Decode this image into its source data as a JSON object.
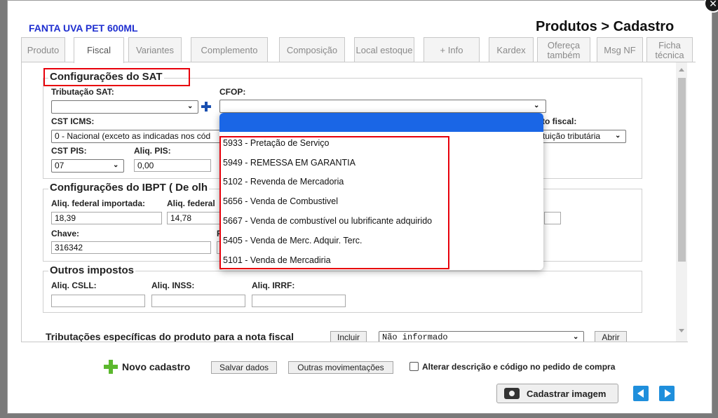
{
  "product_name": "FANTA UVA PET 600ML",
  "page_title": "Produtos > Cadastro",
  "tabs": [
    {
      "label": "Produto"
    },
    {
      "label": "Fiscal"
    },
    {
      "label": "Variantes"
    },
    {
      "label": "Complemento"
    },
    {
      "label": "Composição"
    },
    {
      "label": "Local estoque"
    },
    {
      "label": "+ Info"
    },
    {
      "label": "Kardex"
    },
    {
      "label": "Ofereça também"
    },
    {
      "label": "Msg NF"
    },
    {
      "label": "Ficha técnica"
    }
  ],
  "sat": {
    "legend": "Configurações do SAT",
    "tributacao_label": "Tributação SAT:",
    "tributacao_value": "",
    "cfop_label": "CFOP:",
    "cfop_value": "",
    "cst_icms_label": "CST ICMS:",
    "cst_icms_value": "0 - Nacional (exceto as indicadas nos cód",
    "partial_label_right": "to fiscal:",
    "partial_value_right": "tuição tributária",
    "cst_pis_label": "CST PIS:",
    "cst_pis_value": "07",
    "aliq_pis_label": "Aliq. PIS:",
    "aliq_pis_value": "0,00"
  },
  "ibpt": {
    "legend": "Configurações do IBPT ( De olh",
    "federal_importada_label": "Aliq. federal importada:",
    "federal_importada_value": "18,39",
    "federal_label": "Aliq. federal",
    "federal_value": "14,78",
    "chave_label": "Chave:",
    "chave_value": "316342",
    "partial_label": "F"
  },
  "outros": {
    "legend": "Outros impostos",
    "csll_label": "Aliq. CSLL:",
    "inss_label": "Aliq. INSS:",
    "irrf_label": "Aliq. IRRF:"
  },
  "tributacoes": {
    "label": "Tributações específicas do produto para a nota fiscal",
    "incluir_label": "Incluir",
    "select_value": "Não informado",
    "abrir_label": "Abrir"
  },
  "cfop_options": [
    "5933 - Pretação de Serviço",
    "5949 - REMESSA EM GARANTIA",
    "5102 - Revenda de Mercadoria",
    "5656 - Venda de Combustivel",
    "5667 - Venda de combustível ou lubrificante adquirido",
    "5405 - Venda de Merc. Adquir. Terc.",
    "5101 - Venda de Mercadiria"
  ],
  "footer": {
    "novo_cadastro_label": "Novo cadastro",
    "salvar_label": "Salvar dados",
    "outras_label": "Outras movimentações",
    "alterar_label": "Alterar descrição e código no pedido de compra",
    "cadastrar_imagem_label": "Cadastrar imagem"
  },
  "colors": {
    "accent_blue": "#1f2fd0",
    "highlight_red": "#e8000b",
    "selected_blue": "#1a66e6",
    "plus_green": "#5cb82e"
  }
}
